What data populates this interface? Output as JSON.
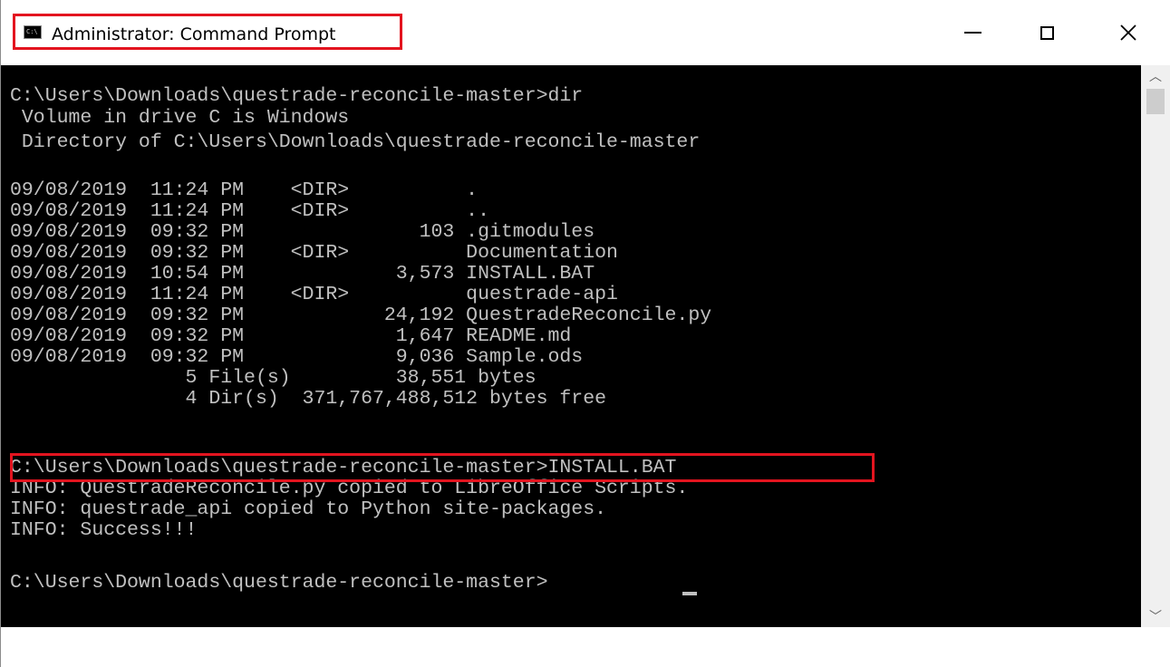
{
  "window": {
    "title": "Administrator: Command Prompt",
    "icon_name": "cmd-app-icon",
    "icon_text": "C:\\",
    "controls": {
      "minimize": "minimize-icon",
      "maximize": "maximize-icon",
      "close": "close-icon",
      "close_glyph": "✕"
    }
  },
  "console": {
    "lines": [
      "C:\\Users\\Downloads\\questrade-reconcile-master>dir",
      " Volume in drive C is Windows",
      " Directory of C:\\Users\\Downloads\\questrade-reconcile-master",
      "",
      "09/08/2019  11:24 PM    <DIR>          .",
      "09/08/2019  11:24 PM    <DIR>          ..",
      "09/08/2019  09:32 PM               103 .gitmodules",
      "09/08/2019  09:32 PM    <DIR>          Documentation",
      "09/08/2019  10:54 PM             3,573 INSTALL.BAT",
      "09/08/2019  11:24 PM    <DIR>          questrade-api",
      "09/08/2019  09:32 PM            24,192 QuestradeReconcile.py",
      "09/08/2019  09:32 PM             1,647 README.md",
      "09/08/2019  09:32 PM             9,036 Sample.ods",
      "               5 File(s)         38,551 bytes",
      "               4 Dir(s)  371,767,488,512 bytes free",
      "",
      "C:\\Users\\Downloads\\questrade-reconcile-master>INSTALL.BAT",
      "INFO: QuestradeReconcile.py copied to LibreOffice Scripts.",
      "INFO: questrade_api copied to Python site-packages.",
      "INFO: Success!!!",
      "",
      "C:\\Users\\Downloads\\questrade-reconcile-master>"
    ],
    "text_color": "#c0c0c0",
    "background": "#000000",
    "highlight_color": "#e3141f"
  },
  "scrollbar": {
    "up_glyph": "︿",
    "down_glyph": "﹀"
  }
}
